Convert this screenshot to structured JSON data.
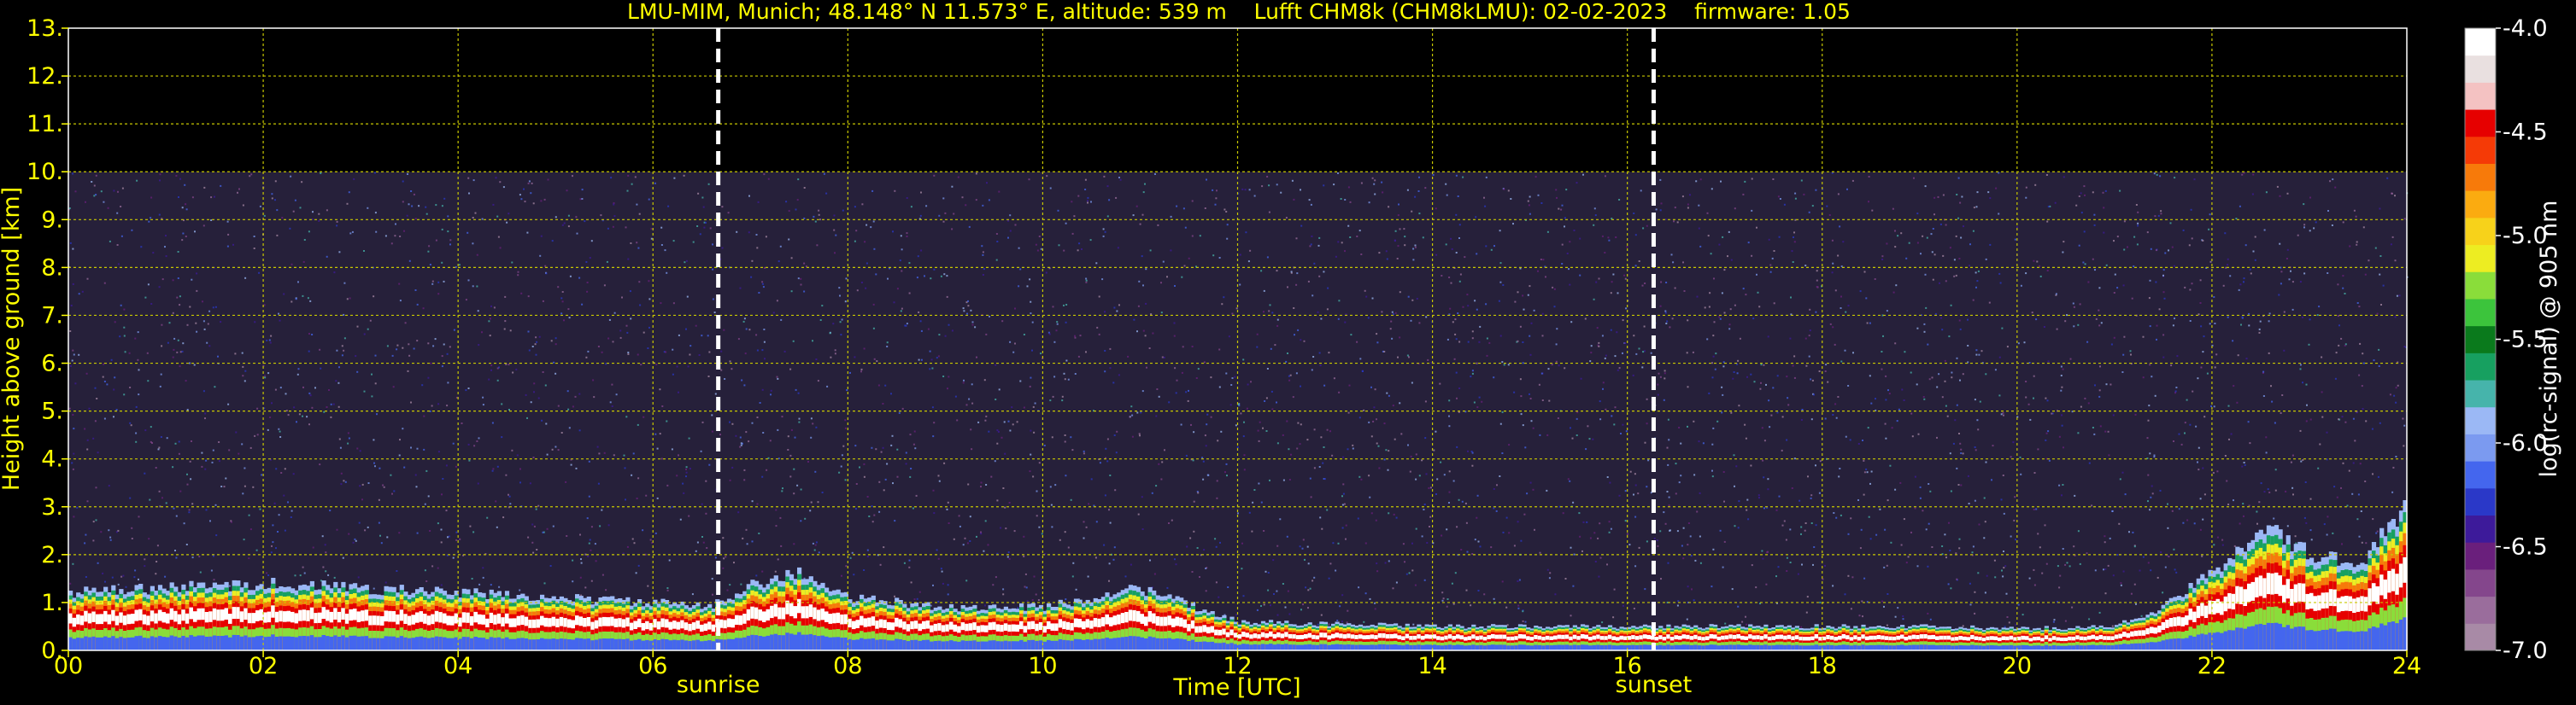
{
  "chart_data": {
    "type": "heatmap",
    "title": "LMU-MIM, Munich; 48.148° N 11.573° E, altitude: 539 m    Lufft CHM8k (CHM8kLMU): 02-02-2023    firmware: 1.05",
    "xlabel": "Time [UTC]",
    "ylabel": "Height above ground [km]",
    "xlim": [
      0,
      24
    ],
    "ylim": [
      0,
      13
    ],
    "x_ticks": [
      "00",
      "02",
      "04",
      "06",
      "08",
      "10",
      "12",
      "14",
      "16",
      "18",
      "20",
      "22",
      "24"
    ],
    "y_ticks": [
      "0.",
      "1.",
      "2.",
      "3.",
      "4.",
      "5.",
      "6.",
      "7.",
      "8.",
      "9.",
      "10.",
      "11.",
      "12.",
      "13."
    ],
    "grid": true,
    "data_top_km": 10,
    "markers": [
      {
        "label": "sunrise",
        "x": 6.67
      },
      {
        "label": "sunset",
        "x": 16.27
      }
    ],
    "colorbar": {
      "label": "log(rc-signal) @ 905 nm",
      "min": -7.0,
      "max": -4.0,
      "ticks": [
        "-4.0",
        "-4.5",
        "-5.0",
        "-5.5",
        "-6.0",
        "-6.5",
        "-7.0"
      ]
    },
    "boundary_layer_top_km": [
      [
        0.0,
        1.2
      ],
      [
        1.0,
        1.3
      ],
      [
        2.0,
        1.4
      ],
      [
        3.0,
        1.3
      ],
      [
        4.0,
        1.2
      ],
      [
        5.0,
        1.1
      ],
      [
        6.0,
        1.0
      ],
      [
        6.6,
        0.9
      ],
      [
        7.0,
        1.4
      ],
      [
        7.5,
        1.6
      ],
      [
        8.0,
        1.1
      ],
      [
        9.0,
        0.9
      ],
      [
        10.0,
        0.9
      ],
      [
        11.0,
        1.3
      ],
      [
        12.0,
        0.6
      ],
      [
        13.0,
        0.55
      ],
      [
        14.0,
        0.5
      ],
      [
        15.0,
        0.5
      ],
      [
        16.0,
        0.5
      ],
      [
        17.0,
        0.5
      ],
      [
        18.0,
        0.5
      ],
      [
        19.0,
        0.5
      ],
      [
        20.0,
        0.45
      ],
      [
        21.0,
        0.5
      ],
      [
        21.5,
        0.9
      ],
      [
        22.0,
        1.6
      ],
      [
        22.5,
        2.6
      ],
      [
        23.0,
        2.0
      ],
      [
        23.5,
        1.8
      ],
      [
        24.0,
        3.0
      ]
    ]
  },
  "colors": {
    "axis_text": "#ffff00",
    "colorbar_text": "#ffffff",
    "grid": "#c8c800",
    "background": "#000000",
    "colormap": [
      "#a88aa6",
      "#9a6d9c",
      "#84468c",
      "#6a1f7c",
      "#3d1a9a",
      "#2a38c8",
      "#4466ee",
      "#7b9af0",
      "#9bb8f5",
      "#46b4ab",
      "#17a060",
      "#0a7a1c",
      "#3cc43c",
      "#8add3a",
      "#eded22",
      "#f7d21a",
      "#fbab10",
      "#f77a0a",
      "#f53a06",
      "#e60000",
      "#f4c2c2",
      "#e9e0e0",
      "#ffffff"
    ]
  }
}
